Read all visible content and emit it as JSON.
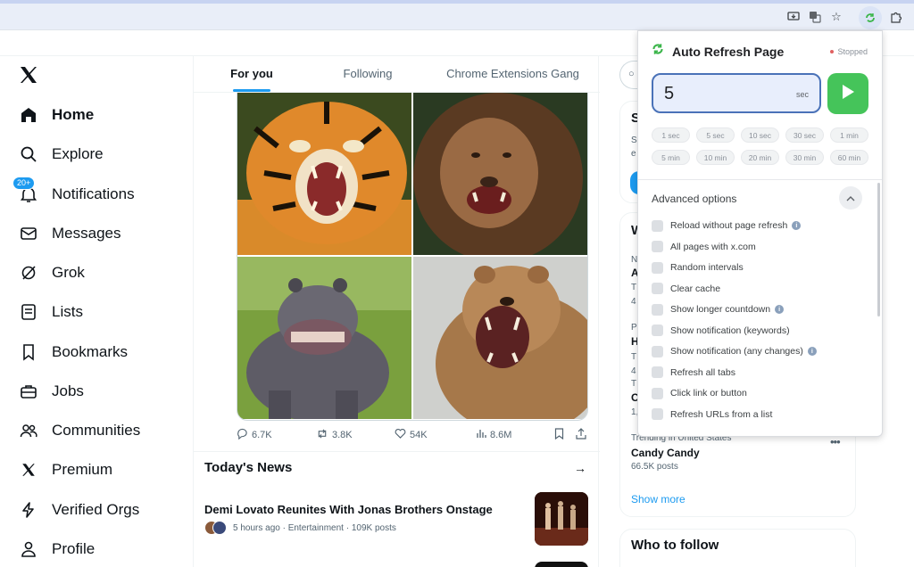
{
  "nav": {
    "items": [
      {
        "label": "Home",
        "icon": "home-icon"
      },
      {
        "label": "Explore",
        "icon": "search-icon"
      },
      {
        "label": "Notifications",
        "icon": "bell-icon",
        "badge": "20+"
      },
      {
        "label": "Messages",
        "icon": "mail-icon"
      },
      {
        "label": "Grok",
        "icon": "grok-icon"
      },
      {
        "label": "Lists",
        "icon": "list-icon"
      },
      {
        "label": "Bookmarks",
        "icon": "bookmark-icon"
      },
      {
        "label": "Jobs",
        "icon": "briefcase-icon"
      },
      {
        "label": "Communities",
        "icon": "people-icon"
      },
      {
        "label": "Premium",
        "icon": "x-icon"
      },
      {
        "label": "Verified Orgs",
        "icon": "bolt-icon"
      },
      {
        "label": "Profile",
        "icon": "person-icon"
      }
    ]
  },
  "tabs": [
    {
      "label": "For you",
      "active": true
    },
    {
      "label": "Following",
      "active": false
    },
    {
      "label": "Chrome Extensions Gang",
      "active": false
    }
  ],
  "post": {
    "replies": "6.7K",
    "reposts": "3.8K",
    "likes": "54K",
    "views": "8.6M"
  },
  "news": {
    "title": "Today's News",
    "item_title": "Demi Lovato Reunites With Jonas Brothers Onstage",
    "item_meta": "5 hours ago · Entertainment · 109K posts"
  },
  "right": {
    "trend_context": "Trending in United States",
    "trend_name": "Candy Candy",
    "trend_count": "66.5K posts",
    "show_more": "Show more",
    "who_to_follow": "Who to follow",
    "partial_letters": [
      "S",
      "S",
      "e",
      "W",
      "N",
      "A",
      "T",
      "4",
      "P",
      "H",
      "T",
      "4",
      "T",
      "C",
      "1,"
    ]
  },
  "popup": {
    "title": "Auto Refresh Page",
    "status": "Stopped",
    "interval_value": "5",
    "interval_unit": "sec",
    "chips_row1": [
      "1 sec",
      "5 sec",
      "10 sec",
      "30 sec",
      "1 min"
    ],
    "chips_row2": [
      "5 min",
      "10 min",
      "20 min",
      "30 min",
      "60 min"
    ],
    "advanced_title": "Advanced options",
    "options": [
      {
        "label": "Reload without page refresh",
        "info": true
      },
      {
        "label": "All pages with x.com",
        "info": false
      },
      {
        "label": "Random intervals",
        "info": false
      },
      {
        "label": "Clear cache",
        "info": false
      },
      {
        "label": "Show longer countdown",
        "info": true
      },
      {
        "label": "Show notification (keywords)",
        "info": false
      },
      {
        "label": "Show notification (any changes)",
        "info": true
      },
      {
        "label": "Refresh all tabs",
        "info": false
      },
      {
        "label": "Click link or button",
        "info": false
      },
      {
        "label": "Refresh URLs from a list",
        "info": false
      }
    ]
  },
  "colors": {
    "accent": "#1d9bf0",
    "play_green": "#45c45a",
    "input_border": "#4a72b8"
  }
}
